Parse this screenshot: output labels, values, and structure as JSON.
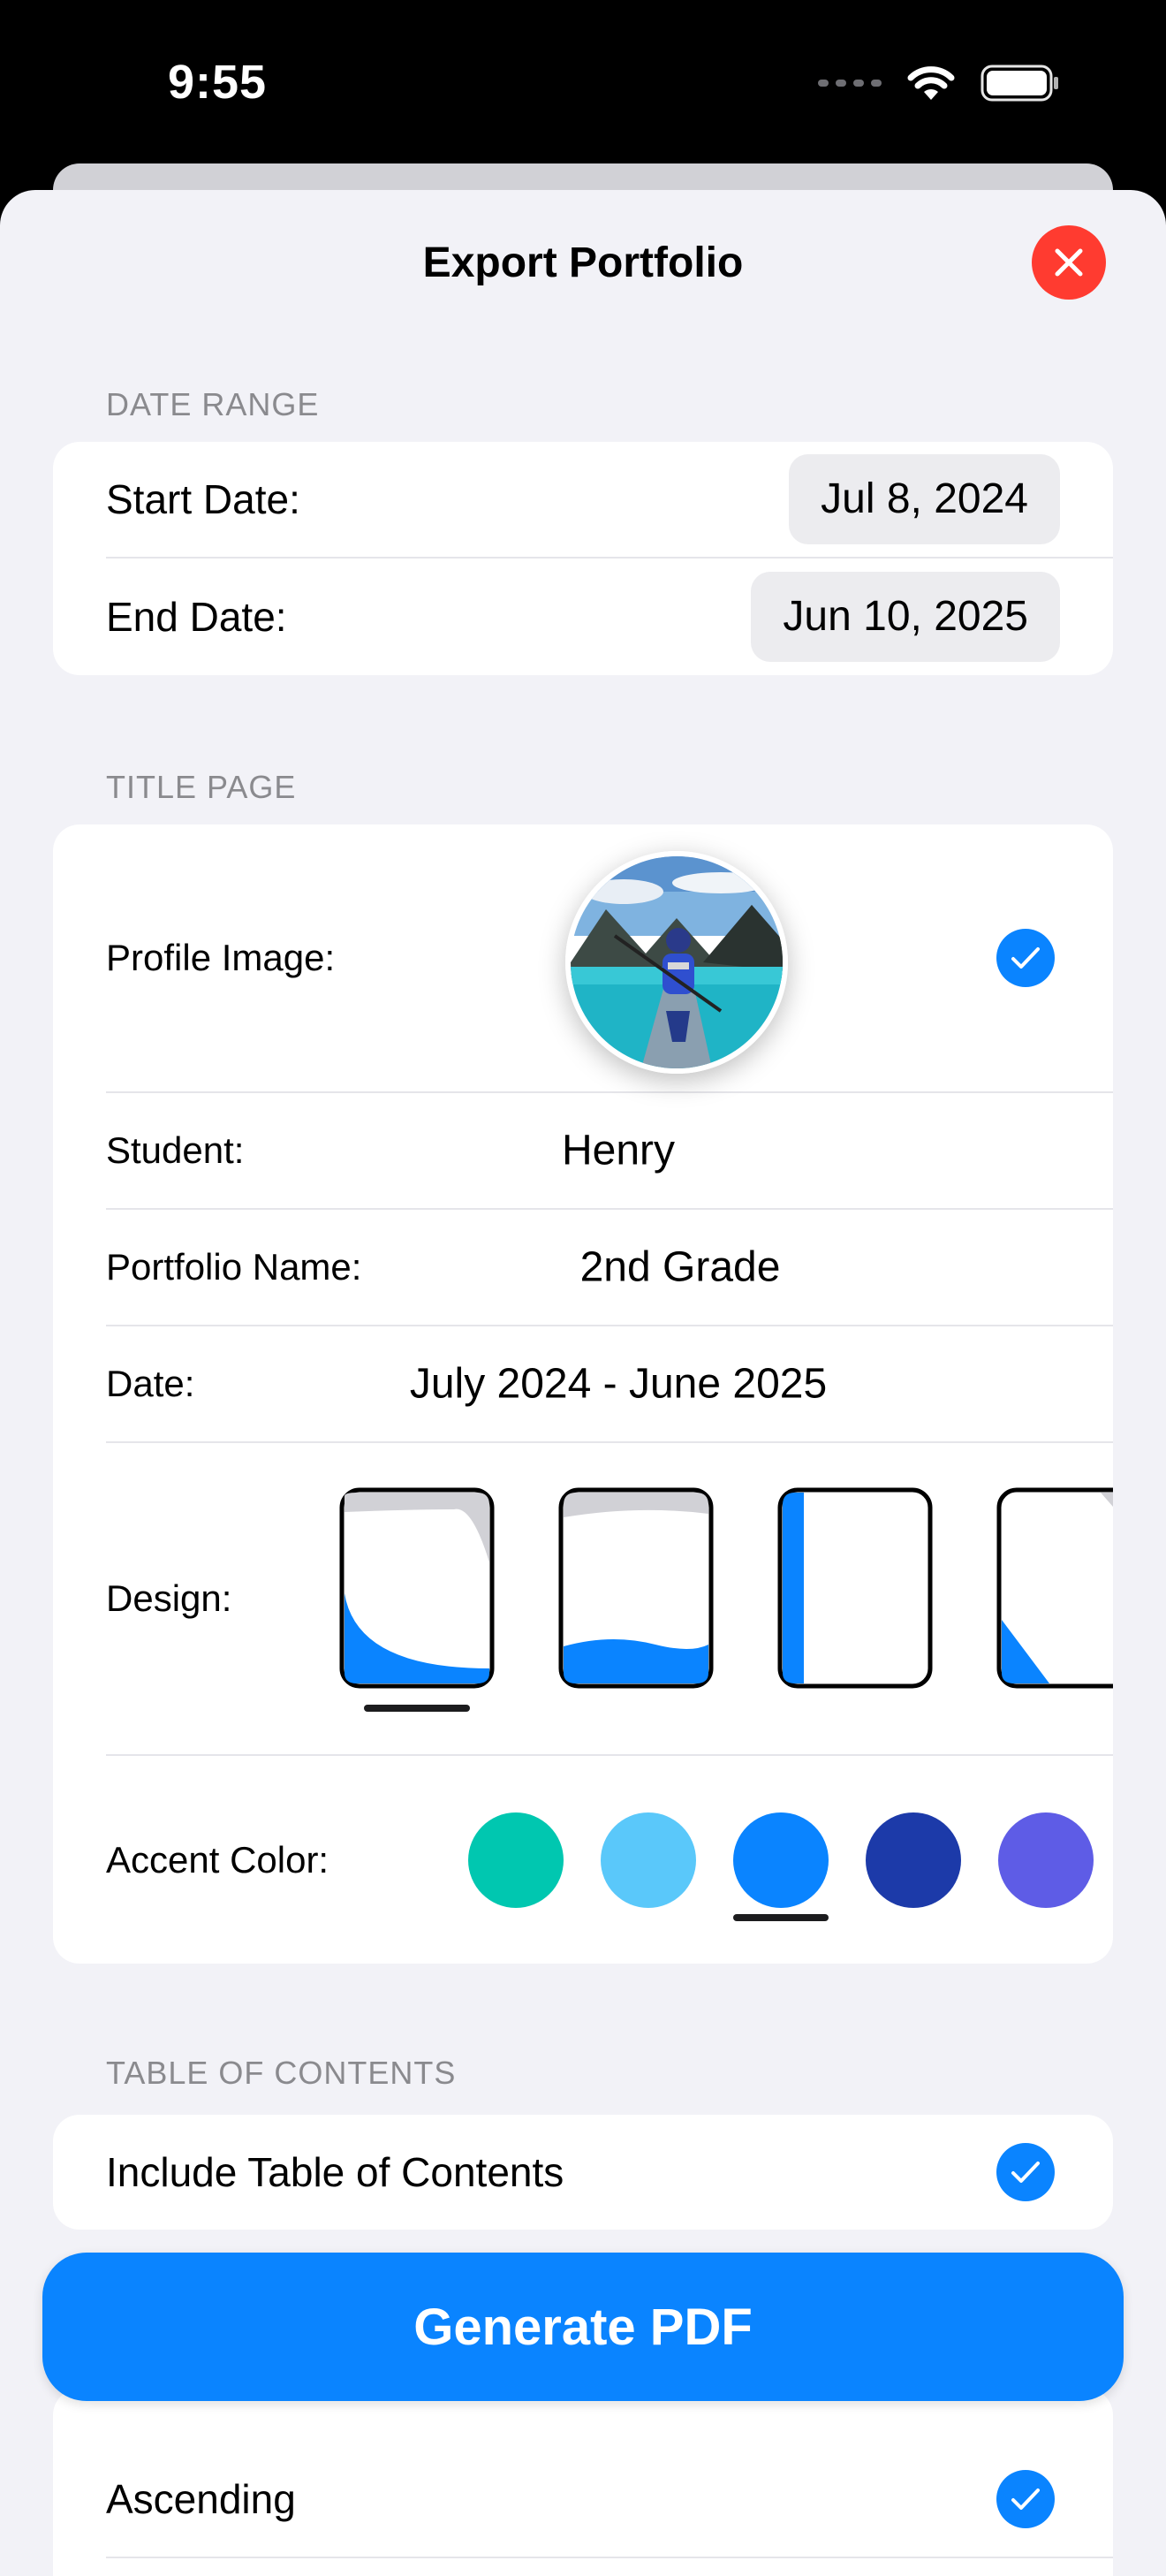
{
  "status_bar": {
    "time": "9:55"
  },
  "sheet": {
    "title": "Export Portfolio"
  },
  "date_range": {
    "header": "DATE RANGE",
    "start_label": "Start Date:",
    "start_value": "Jul 8, 2024",
    "end_label": "End Date:",
    "end_value": "Jun 10, 2025"
  },
  "title_page": {
    "header": "TITLE PAGE",
    "profile_label": "Profile Image:",
    "profile_checked": true,
    "student_label": "Student:",
    "student_value": "Henry",
    "portfolio_label": "Portfolio Name:",
    "portfolio_value": "2nd Grade",
    "date_label": "Date:",
    "date_value": "July 2024 - June 2025",
    "design_label": "Design:",
    "designs": [
      "curve-left",
      "wave-bottom",
      "side-bar",
      "corner-triangle"
    ],
    "selected_design": 0,
    "accent_label": "Accent Color:",
    "accent_colors": [
      "#00c7b0",
      "#5ac8fa",
      "#0a84ff",
      "#1c3aa9",
      "#5e5ce6"
    ],
    "selected_accent": 2
  },
  "toc": {
    "header": "TABLE OF CONTENTS",
    "include_label": "Include Table of Contents",
    "include_checked": true
  },
  "order": {
    "ascending_label": "Ascending",
    "ascending_checked": true
  },
  "generate_button": "Generate PDF"
}
